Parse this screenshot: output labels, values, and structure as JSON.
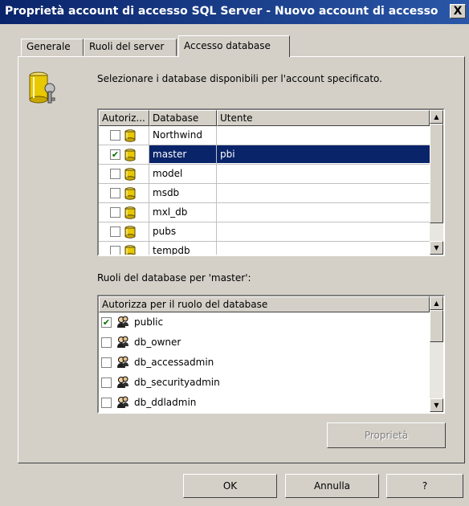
{
  "window": {
    "title": "Proprietà account di accesso SQL Server - Nuovo account di accesso",
    "close_label": "X"
  },
  "tabs": [
    {
      "label": "Generale"
    },
    {
      "label": "Ruoli del server"
    },
    {
      "label": "Accesso database"
    }
  ],
  "panel": {
    "instruction": "Selezionare i database disponibili per l'account specificato.",
    "db_list": {
      "columns": [
        "Autoriz...",
        "Database",
        "Utente"
      ],
      "rows": [
        {
          "checked": false,
          "database": "Northwind",
          "user": ""
        },
        {
          "checked": true,
          "database": "master",
          "user": "pbi",
          "selected": true
        },
        {
          "checked": false,
          "database": "model",
          "user": ""
        },
        {
          "checked": false,
          "database": "msdb",
          "user": ""
        },
        {
          "checked": false,
          "database": "mxl_db",
          "user": ""
        },
        {
          "checked": false,
          "database": "pubs",
          "user": ""
        },
        {
          "checked": false,
          "database": "tempdb",
          "user": ""
        }
      ]
    },
    "roles_label": "Ruoli del database per 'master':",
    "roles_list": {
      "column": "Autorizza per il ruolo del database",
      "rows": [
        {
          "checked": true,
          "role": "public"
        },
        {
          "checked": false,
          "role": "db_owner"
        },
        {
          "checked": false,
          "role": "db_accessadmin"
        },
        {
          "checked": false,
          "role": "db_securityadmin"
        },
        {
          "checked": false,
          "role": "db_ddladmin"
        }
      ]
    },
    "properties_button": "Proprietà"
  },
  "footer": {
    "ok": "OK",
    "cancel": "Annulla",
    "help": "?"
  },
  "colors": {
    "selection": "#0a246a",
    "face": "#d4d0c8",
    "db_icon": "#e8c800"
  }
}
